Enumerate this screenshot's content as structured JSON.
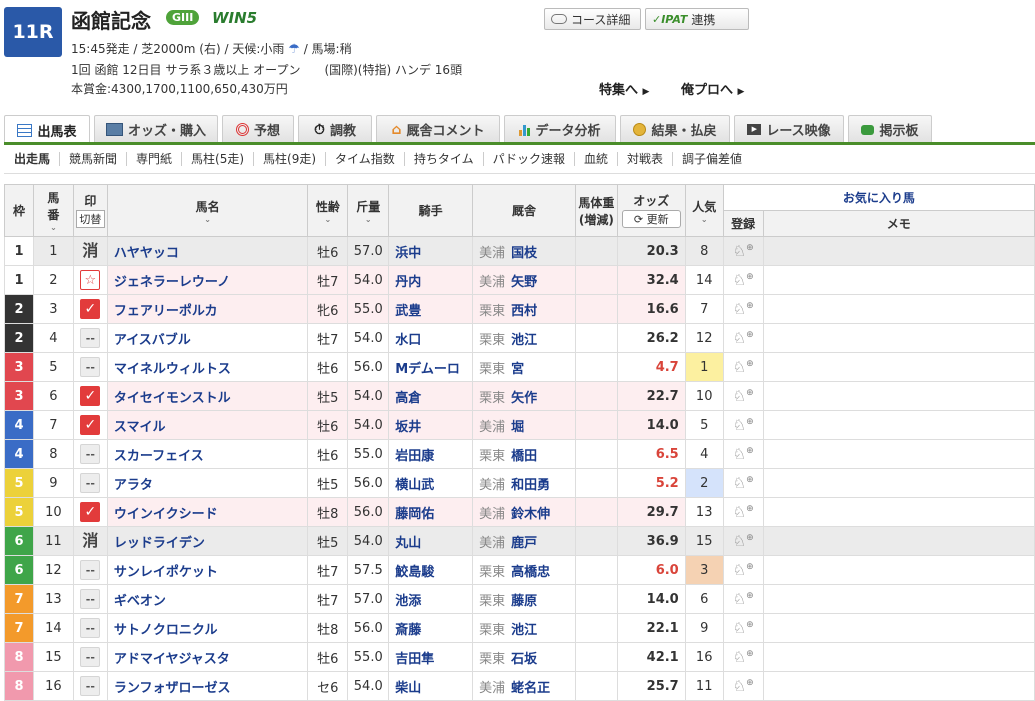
{
  "race": {
    "number": "11R",
    "title": "函館記念",
    "grade": "GIII",
    "win5": "WIN5",
    "info_line1": "15:45発走 / 芝2000m (右) / 天候:小雨",
    "info_line1_tail": "/ 馬場:稍",
    "info_line2": "1回 函館 12日目 サラ系３歳以上 オープン　　(国際)(特指) ハンデ 16頭",
    "info_line3": "本賞金:4300,1700,1100,650,430万円"
  },
  "header_buttons": {
    "course": "コース詳細",
    "ipat": "IPAT",
    "ipat_suffix": "連携",
    "special": "特集へ",
    "pro": "俺プロへ"
  },
  "tabs": [
    {
      "label": "出馬表",
      "icon": "table-icon",
      "active": true
    },
    {
      "label": "オッズ・購入",
      "icon": "odds-icon",
      "active": false
    },
    {
      "label": "予想",
      "icon": "target-icon",
      "active": false
    },
    {
      "label": "調教",
      "icon": "stopwatch-icon",
      "active": false
    },
    {
      "label": "厩舎コメント",
      "icon": "stable-icon",
      "active": false
    },
    {
      "label": "データ分析",
      "icon": "bar-chart-icon",
      "active": false
    },
    {
      "label": "結果・払戻",
      "icon": "coins-icon",
      "active": false
    },
    {
      "label": "レース映像",
      "icon": "video-icon",
      "active": false
    },
    {
      "label": "掲示板",
      "icon": "chat-icon",
      "active": false
    }
  ],
  "subnav": [
    "出走馬",
    "競馬新聞",
    "専門紙",
    "馬柱(5走)",
    "馬柱(9走)",
    "タイム指数",
    "持ちタイム",
    "パドック速報",
    "血統",
    "対戦表",
    "調子偏差値"
  ],
  "table": {
    "headers": {
      "waku": "枠",
      "umaban_1": "馬",
      "umaban_2": "番",
      "mark": "印",
      "mark_toggle": "切替",
      "name": "馬名",
      "sexage": "性齢",
      "weight": "斤量",
      "jockey": "騎手",
      "stable": "厩舎",
      "bodyweight_1": "馬体重",
      "bodyweight_2": "(増減)",
      "odds": "オッズ",
      "odds_refresh": "更新",
      "pop_1": "人気",
      "fav": "お気に入り馬",
      "fav_reg": "登録",
      "fav_memo": "メモ"
    },
    "rows": [
      {
        "waku": "1",
        "num": "1",
        "mark": "消",
        "mark_type": "scr",
        "name": "ハヤヤッコ",
        "sexage": "牡6",
        "weight": "57.0",
        "jockey": "浜中",
        "region": "美浦",
        "trainer": "国枝",
        "odds": "20.3",
        "pop": "8",
        "row_type": "scr"
      },
      {
        "waku": "1",
        "num": "2",
        "mark": "☆",
        "mark_type": "star",
        "name": "ジェネラーレウーノ",
        "sexage": "牡7",
        "weight": "54.0",
        "jockey": "丹内",
        "region": "美浦",
        "trainer": "矢野",
        "odds": "32.4",
        "pop": "14",
        "row_type": "pink"
      },
      {
        "waku": "2",
        "num": "3",
        "mark": "✓",
        "mark_type": "check",
        "name": "フェアリーポルカ",
        "sexage": "牝6",
        "weight": "55.0",
        "jockey": "武豊",
        "region": "栗東",
        "trainer": "西村",
        "odds": "16.6",
        "pop": "7",
        "row_type": "pink"
      },
      {
        "waku": "2",
        "num": "4",
        "mark": "--",
        "mark_type": "none",
        "name": "アイスバブル",
        "sexage": "牡7",
        "weight": "54.0",
        "jockey": "水口",
        "region": "栗東",
        "trainer": "池江",
        "odds": "26.2",
        "pop": "12",
        "row_type": ""
      },
      {
        "waku": "3",
        "num": "5",
        "mark": "--",
        "mark_type": "none",
        "name": "マイネルウィルトス",
        "sexage": "牡6",
        "weight": "56.0",
        "jockey": "Mデムーロ",
        "region": "栗東",
        "trainer": "宮",
        "odds": "4.7",
        "pop": "1",
        "row_type": "",
        "hot": true,
        "pop_color": "#fcf0a0"
      },
      {
        "waku": "3",
        "num": "6",
        "mark": "✓",
        "mark_type": "check",
        "name": "タイセイモンストル",
        "sexage": "牡5",
        "weight": "54.0",
        "jockey": "高倉",
        "region": "栗東",
        "trainer": "矢作",
        "odds": "22.7",
        "pop": "10",
        "row_type": "pink"
      },
      {
        "waku": "4",
        "num": "7",
        "mark": "✓",
        "mark_type": "check",
        "name": "スマイル",
        "sexage": "牡6",
        "weight": "54.0",
        "jockey": "坂井",
        "region": "美浦",
        "trainer": "堀",
        "odds": "14.0",
        "pop": "5",
        "row_type": "pink"
      },
      {
        "waku": "4",
        "num": "8",
        "mark": "--",
        "mark_type": "none",
        "name": "スカーフェイス",
        "sexage": "牡6",
        "weight": "55.0",
        "jockey": "岩田康",
        "region": "栗東",
        "trainer": "橋田",
        "odds": "6.5",
        "pop": "4",
        "row_type": "",
        "hot": true
      },
      {
        "waku": "5",
        "num": "9",
        "mark": "--",
        "mark_type": "none",
        "name": "アラタ",
        "sexage": "牡5",
        "weight": "56.0",
        "jockey": "横山武",
        "region": "美浦",
        "trainer": "和田勇",
        "odds": "5.2",
        "pop": "2",
        "row_type": "",
        "hot": true,
        "pop_color": "#d5e3fb"
      },
      {
        "waku": "5",
        "num": "10",
        "mark": "✓",
        "mark_type": "check",
        "name": "ウインイクシード",
        "sexage": "牡8",
        "weight": "56.0",
        "jockey": "藤岡佑",
        "region": "美浦",
        "trainer": "鈴木伸",
        "odds": "29.7",
        "pop": "13",
        "row_type": "pink"
      },
      {
        "waku": "6",
        "num": "11",
        "mark": "消",
        "mark_type": "scr",
        "name": "レッドライデン",
        "sexage": "牡5",
        "weight": "54.0",
        "jockey": "丸山",
        "region": "美浦",
        "trainer": "鹿戸",
        "odds": "36.9",
        "pop": "15",
        "row_type": "scr"
      },
      {
        "waku": "6",
        "num": "12",
        "mark": "--",
        "mark_type": "none",
        "name": "サンレイポケット",
        "sexage": "牡7",
        "weight": "57.5",
        "jockey": "鮫島駿",
        "region": "栗東",
        "trainer": "高橋忠",
        "odds": "6.0",
        "pop": "3",
        "row_type": "",
        "hot": true,
        "pop_color": "#f5d2b3"
      },
      {
        "waku": "7",
        "num": "13",
        "mark": "--",
        "mark_type": "none",
        "name": "ギベオン",
        "sexage": "牡7",
        "weight": "57.0",
        "jockey": "池添",
        "region": "栗東",
        "trainer": "藤原",
        "odds": "14.0",
        "pop": "6",
        "row_type": ""
      },
      {
        "waku": "7",
        "num": "14",
        "mark": "--",
        "mark_type": "none",
        "name": "サトノクロニクル",
        "sexage": "牡8",
        "weight": "56.0",
        "jockey": "斎藤",
        "region": "栗東",
        "trainer": "池江",
        "odds": "22.1",
        "pop": "9",
        "row_type": ""
      },
      {
        "waku": "8",
        "num": "15",
        "mark": "--",
        "mark_type": "none",
        "name": "アドマイヤジャスタ",
        "sexage": "牡6",
        "weight": "55.0",
        "jockey": "吉田隼",
        "region": "栗東",
        "trainer": "石坂",
        "odds": "42.1",
        "pop": "16",
        "row_type": ""
      },
      {
        "waku": "8",
        "num": "16",
        "mark": "--",
        "mark_type": "none",
        "name": "ランフォザローゼス",
        "sexage": "セ6",
        "weight": "54.0",
        "jockey": "柴山",
        "region": "美浦",
        "trainer": "蛯名正",
        "odds": "25.7",
        "pop": "11",
        "row_type": ""
      }
    ]
  },
  "colors": {
    "waku": {
      "1": [
        "#ffffff",
        "#333333"
      ],
      "2": [
        "#333333",
        "#ffffff"
      ],
      "3": [
        "#e1474f",
        "#ffffff"
      ],
      "4": [
        "#3a6cc6",
        "#ffffff"
      ],
      "5": [
        "#ecd13a",
        "#ffffff"
      ],
      "6": [
        "#3fa549",
        "#ffffff"
      ],
      "7": [
        "#f39a2b",
        "#ffffff"
      ],
      "8": [
        "#f199ad",
        "#ffffff"
      ]
    },
    "accent_green": "#4a8d2a",
    "race_badge": "#2a59a8"
  }
}
